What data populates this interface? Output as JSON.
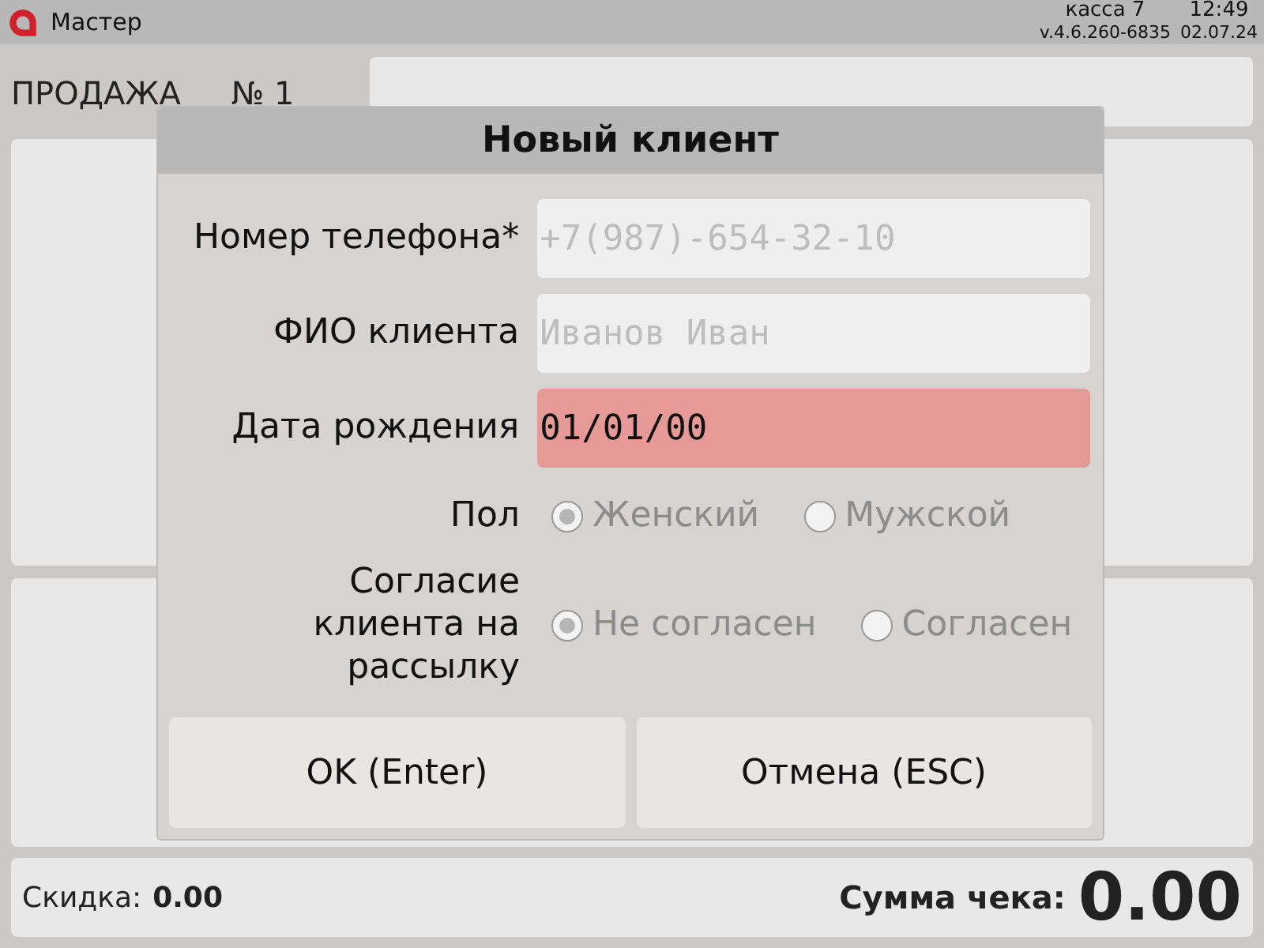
{
  "top_bar": {
    "app_name": "Мастер",
    "register": "касса 7",
    "time": "12:49",
    "version": "v.4.6.260-6835",
    "date": "02.07.24"
  },
  "sale": {
    "title": "ПРОДАЖА",
    "number": "№ 1"
  },
  "dialog": {
    "title": "Новый клиент",
    "fields": [
      {
        "label": "Номер телефона*",
        "placeholder": "+7(987)-654-32-10",
        "invalid": false
      },
      {
        "label": "ФИО клиента",
        "placeholder": "Иванов Иван",
        "invalid": false
      },
      {
        "label": "Дата рождения",
        "value": "01/01/00",
        "invalid": true
      }
    ],
    "radio_groups": [
      {
        "label": "Пол",
        "options": [
          {
            "label": "Женский",
            "selected": true
          },
          {
            "label": "Мужской",
            "selected": false
          }
        ]
      },
      {
        "label": "Согласие клиента на рассылку",
        "options": [
          {
            "label": "Не согласен",
            "selected": true
          },
          {
            "label": "Согласен",
            "selected": false
          }
        ]
      }
    ],
    "buttons": [
      "OK (Enter)",
      "Отмена (ESC)"
    ]
  },
  "footer": {
    "discount_label": "Скидка:",
    "discount": "0.00",
    "total_label": "Сумма чека:",
    "total": "0.00"
  }
}
